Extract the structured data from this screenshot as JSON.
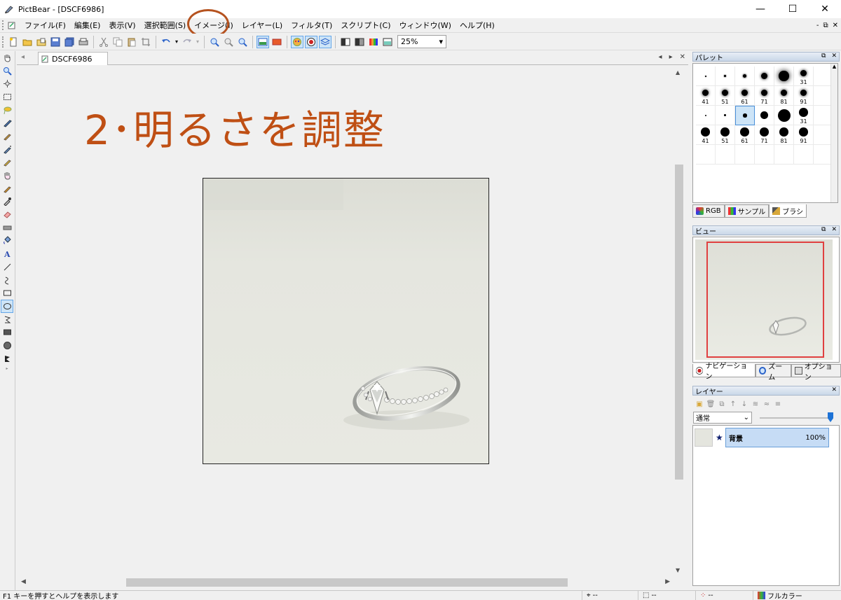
{
  "window": {
    "title": "PictBear - [DSCF6986]",
    "minimize": "—",
    "maximize": "☐",
    "close": "✕"
  },
  "menu": {
    "items": [
      {
        "label": "ファイル(F)"
      },
      {
        "label": "編集(E)"
      },
      {
        "label": "表示(V)"
      },
      {
        "label": "選択範囲(S)"
      },
      {
        "label": "イメージ(I)",
        "highlighted": true
      },
      {
        "label": "レイヤー(L)"
      },
      {
        "label": "フィルタ(T)"
      },
      {
        "label": "スクリプト(C)"
      },
      {
        "label": "ウィンドウ(W)"
      },
      {
        "label": "ヘルプ(H)"
      }
    ],
    "mdi_min": "-",
    "mdi_restore": "⧉",
    "mdi_close": "✕"
  },
  "toolbar": {
    "zoom_value": "25%",
    "zoom_arrow": "▾"
  },
  "document": {
    "tab_label": "DSCF6986",
    "tab_prev": "◂",
    "tab_next": "▸",
    "tab_close": "✕",
    "tab_back": "◂",
    "annotation": "2･明るさを調整"
  },
  "palette": {
    "header": "パレット",
    "brush_sizes_row1": [
      "",
      "",
      "",
      "",
      "",
      "31"
    ],
    "brush_sizes_row2": [
      "41",
      "51",
      "61",
      "71",
      "81",
      "91"
    ],
    "brush_sizes_row3": [
      "",
      "",
      "",
      "",
      "",
      "31"
    ],
    "brush_sizes_row4": [
      "41",
      "51",
      "61",
      "71",
      "81",
      "91"
    ],
    "tabs": [
      "RGB",
      "サンプル",
      "ブラシ"
    ]
  },
  "view": {
    "header": "ビュー",
    "tabs": [
      "ナビゲーション",
      "ズーム",
      "オプション"
    ]
  },
  "layers": {
    "header": "レイヤー",
    "blend_mode": "通常",
    "layer_name": "背景",
    "layer_opacity": "100%",
    "opacity_level": 1.0
  },
  "status": {
    "help_text": "F1 キーを押すとヘルプを表示します",
    "coord1": "--",
    "coord2": "--",
    "coord3": "--",
    "color_mode": "フルカラー"
  },
  "colors": {
    "annotation": "#bf4f14",
    "highlight_circle": "#b5521f",
    "nav_rect": "#e04040",
    "selection": "#c6dcf5"
  }
}
